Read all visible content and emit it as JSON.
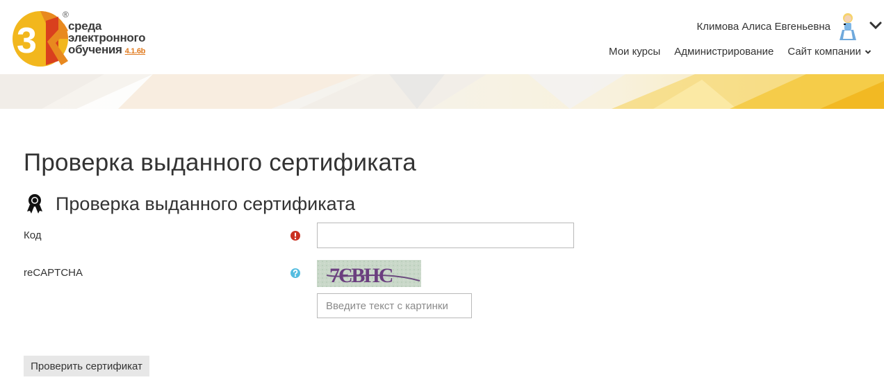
{
  "header": {
    "logo": {
      "line1": "среда",
      "line2": "электронного",
      "line3": "обучения",
      "version": "4.1.6b",
      "registered": "®"
    },
    "user_name": "Климова Алиса Евгеньевна",
    "nav": [
      {
        "label": "Мои курсы"
      },
      {
        "label": "Администрирование"
      },
      {
        "label": "Сайт компании"
      }
    ]
  },
  "page": {
    "title": "Проверка выданного сертификата",
    "section_title": "Проверка выданного сертификата"
  },
  "form": {
    "code_label": "Код",
    "code_value": "",
    "recaptcha_label": "reCAPTCHA",
    "captcha_placeholder": "Введите текст с картинки",
    "captcha_image_text": "7ЄВНС",
    "submit_label": "Проверить сертификат"
  },
  "colors": {
    "brand_orange": "#e8891f",
    "brand_red": "#d9401e",
    "brand_yellow": "#f2b71d",
    "required": "#ca3120",
    "help": "#55bde0"
  },
  "icons": {
    "user_menu": "chevron-down-icon",
    "nav_dropdown": "caret-down-icon",
    "section": "award-icon",
    "required": "exclamation-circle-icon",
    "help": "question-circle-icon"
  }
}
